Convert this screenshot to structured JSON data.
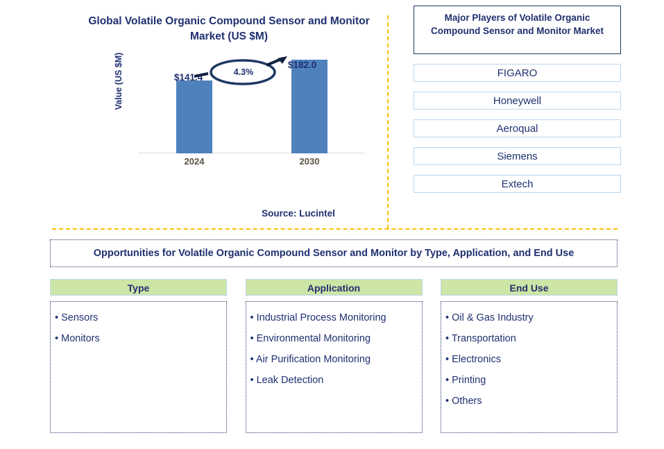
{
  "chart_panel": {
    "title": "Global Volatile Organic Compound Sensor and Monitor Market (US $M)",
    "y_axis_label": "Value (US $M)",
    "source": "Source: Lucintel"
  },
  "chart_data": {
    "type": "bar",
    "title": "Global Volatile Organic Compound Sensor and Monitor Market (US $M)",
    "xlabel": "",
    "ylabel": "Value (US $M)",
    "categories": [
      "2024",
      "2030"
    ],
    "values": [
      141.4,
      182.0
    ],
    "value_labels": [
      "$141.4",
      "$182.0"
    ],
    "ylim": [
      0,
      200
    ],
    "grid": false,
    "legend": "none",
    "bar_color": "#4F81BD",
    "annotation": {
      "cagr_label": "4.3%",
      "from_category": "2024",
      "to_category": "2030",
      "shape": "ellipse-with-arrow"
    }
  },
  "players": {
    "title": "Major Players of Volatile Organic Compound Sensor and Monitor Market",
    "items": [
      {
        "name": "FIGARO"
      },
      {
        "name": "Honeywell"
      },
      {
        "name": "Aeroqual"
      },
      {
        "name": "Siemens"
      },
      {
        "name": "Extech"
      }
    ]
  },
  "opportunities": {
    "banner": "Opportunities for Volatile Organic Compound Sensor and Monitor by Type, Application, and End Use",
    "columns": [
      {
        "header": "Type",
        "items": [
          "Sensors",
          "Monitors"
        ]
      },
      {
        "header": "Application",
        "items": [
          "Industrial Process Monitoring",
          "Environmental Monitoring",
          "Air Purification Monitoring",
          "Leak Detection"
        ]
      },
      {
        "header": "End Use",
        "items": [
          "Oil & Gas Industry",
          "Transportation",
          "Electronics",
          "Printing",
          "Others"
        ]
      }
    ]
  },
  "colors": {
    "navy": "#1F3070",
    "bar_blue": "#4F81BD",
    "divider_yellow": "#FFC000",
    "header_green": "#CDE5A6",
    "box_border_light_blue": "#BDD7EE"
  }
}
